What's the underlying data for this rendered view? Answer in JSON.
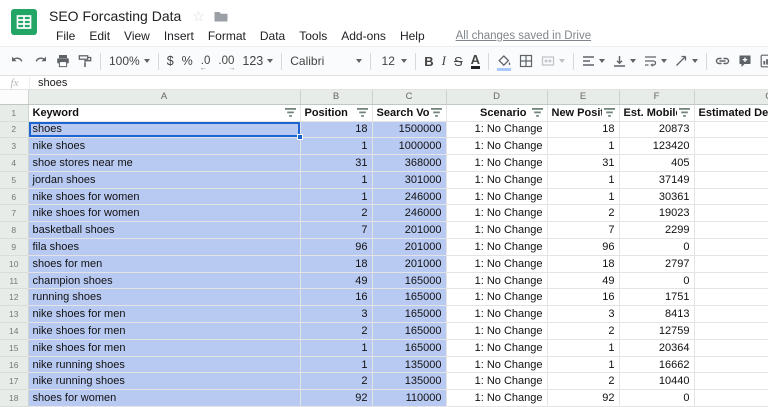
{
  "titlebar": {
    "title": "SEO Forcasting Data",
    "menu": [
      "File",
      "Edit",
      "View",
      "Insert",
      "Format",
      "Data",
      "Tools",
      "Add-ons",
      "Help"
    ],
    "save_status": "All changes saved in Drive",
    "star_glyph": "☆"
  },
  "toolbar": {
    "zoom_level": "100%",
    "currency": "$",
    "percent": "%",
    "decrease_decimal": ".0",
    "increase_decimal": ".00",
    "number_format": "123",
    "font_family": "Calibri",
    "font_size": "12",
    "bold": "B",
    "italic": "I",
    "strikethrough": "S",
    "text_color": "A",
    "filter_active_color": "#188038"
  },
  "formula_bar": {
    "label": "fx",
    "value": "shoes"
  },
  "grid": {
    "column_letters": [
      "A",
      "B",
      "C",
      "D",
      "E",
      "F",
      "G"
    ],
    "header_row": {
      "keyword": "Keyword",
      "position": "Position",
      "search_volume": "Search Volu",
      "scenario": "Scenario",
      "new_position": "New Position",
      "est_mobile": "Est. Mobile T",
      "est_desktop": "Estimated Deskto"
    },
    "selection_color": "#b8c9f2",
    "active_cell": {
      "row": 2,
      "col": 0
    },
    "rows": [
      {
        "n": "2",
        "c": [
          "shoes",
          "18",
          "1500000",
          "1: No Change",
          "18",
          "20873"
        ]
      },
      {
        "n": "3",
        "c": [
          "nike shoes",
          "1",
          "1000000",
          "1: No Change",
          "1",
          "123420"
        ]
      },
      {
        "n": "4",
        "c": [
          "shoe stores near me",
          "31",
          "368000",
          "1: No Change",
          "31",
          "405"
        ]
      },
      {
        "n": "5",
        "c": [
          "jordan shoes",
          "1",
          "301000",
          "1: No Change",
          "1",
          "37149"
        ]
      },
      {
        "n": "6",
        "c": [
          "nike shoes for women",
          "1",
          "246000",
          "1: No Change",
          "1",
          "30361"
        ]
      },
      {
        "n": "7",
        "c": [
          "nike shoes for women",
          "2",
          "246000",
          "1: No Change",
          "2",
          "19023"
        ]
      },
      {
        "n": "8",
        "c": [
          "basketball shoes",
          "7",
          "201000",
          "1: No Change",
          "7",
          "2299"
        ]
      },
      {
        "n": "9",
        "c": [
          "fila shoes",
          "96",
          "201000",
          "1: No Change",
          "96",
          "0"
        ]
      },
      {
        "n": "10",
        "c": [
          "shoes for men",
          "18",
          "201000",
          "1: No Change",
          "18",
          "2797"
        ]
      },
      {
        "n": "11",
        "c": [
          "champion shoes",
          "49",
          "165000",
          "1: No Change",
          "49",
          "0"
        ]
      },
      {
        "n": "12",
        "c": [
          "running shoes",
          "16",
          "165000",
          "1: No Change",
          "16",
          "1751"
        ]
      },
      {
        "n": "13",
        "c": [
          "nike shoes for men",
          "3",
          "165000",
          "1: No Change",
          "3",
          "8413"
        ]
      },
      {
        "n": "14",
        "c": [
          "nike shoes for men",
          "2",
          "165000",
          "1: No Change",
          "2",
          "12759"
        ]
      },
      {
        "n": "15",
        "c": [
          "nike shoes for men",
          "1",
          "165000",
          "1: No Change",
          "1",
          "20364"
        ]
      },
      {
        "n": "16",
        "c": [
          "nike running shoes",
          "1",
          "135000",
          "1: No Change",
          "1",
          "16662"
        ]
      },
      {
        "n": "17",
        "c": [
          "nike running shoes",
          "2",
          "135000",
          "1: No Change",
          "2",
          "10440"
        ]
      },
      {
        "n": "18",
        "c": [
          "shoes for women",
          "92",
          "110000",
          "1: No Change",
          "92",
          "0"
        ]
      }
    ]
  }
}
